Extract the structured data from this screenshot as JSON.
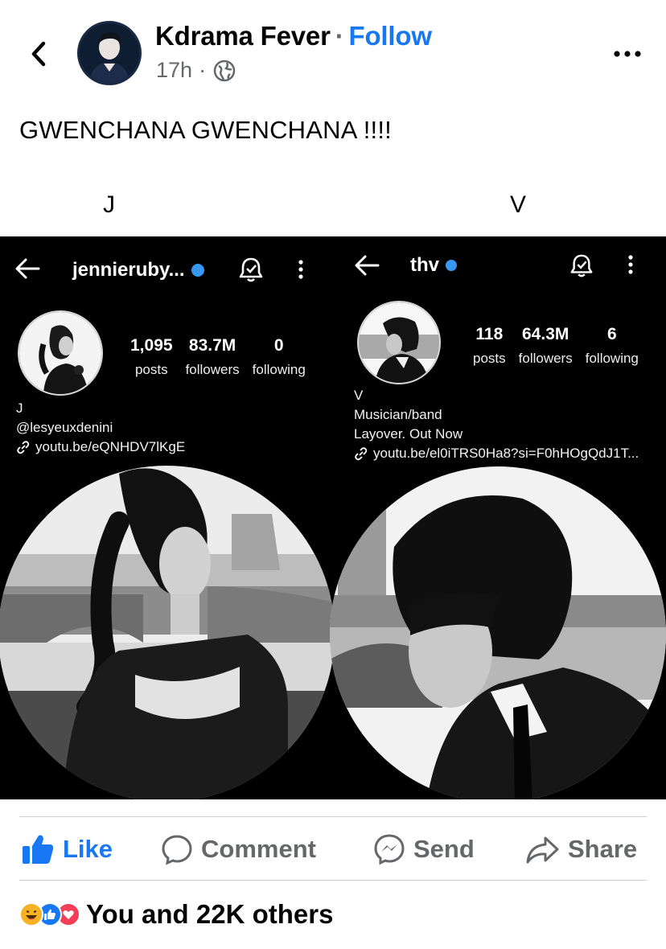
{
  "post": {
    "author": "Kdrama Fever",
    "separator": "·",
    "follow_label": "Follow",
    "time": "17h",
    "meta_separator": "·",
    "audience_icon": "globe-icon",
    "text": "GWENCHANA GWENCHANA !!!!",
    "label_left": "J",
    "label_right": "V"
  },
  "image": {
    "left_profile": {
      "username": "jennieruby...",
      "stats": [
        {
          "value": "1,095",
          "label": "posts"
        },
        {
          "value": "83.7M",
          "label": "followers"
        },
        {
          "value": "0",
          "label": "following"
        }
      ],
      "bio_name": "J",
      "bio_line": "@lesyeuxdenini",
      "link": "youtu.be/eQNHDV7lKgE"
    },
    "right_profile": {
      "username": "thv",
      "stats": [
        {
          "value": "118",
          "label": "posts"
        },
        {
          "value": "64.3M",
          "label": "followers"
        },
        {
          "value": "6",
          "label": "following"
        }
      ],
      "bio_name": "V",
      "bio_category": "Musician/band",
      "bio_line": "Layover. Out Now",
      "link": "youtu.be/el0iTRS0Ha8?si=F0hHOgQdJ1T..."
    }
  },
  "actions": {
    "like": "Like",
    "comment": "Comment",
    "send": "Send",
    "share": "Share"
  },
  "reactions": {
    "summary": "You and 22K others",
    "icons": [
      "haha-icon",
      "like-icon",
      "love-icon"
    ]
  },
  "colors": {
    "accent": "#1877f2",
    "muted": "#65676b",
    "love": "#f33e58",
    "haha": "#f7b125"
  }
}
